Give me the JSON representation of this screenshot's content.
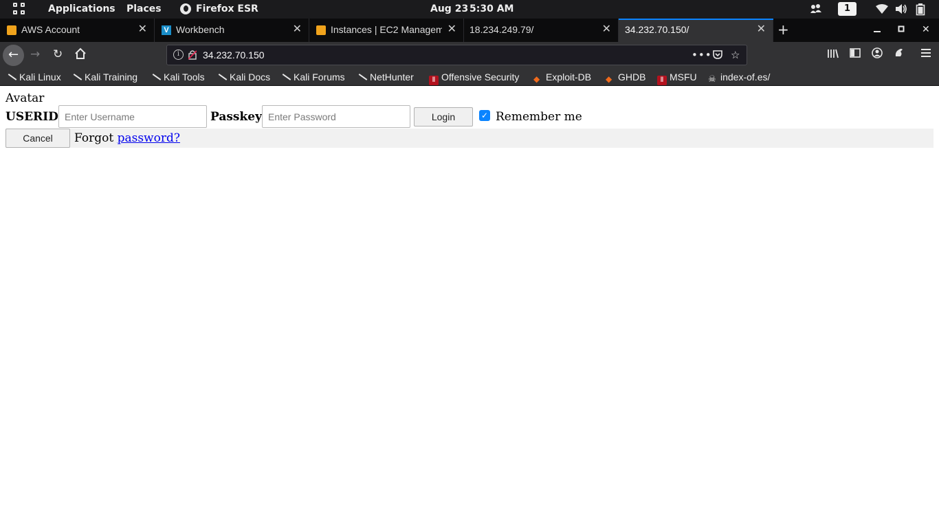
{
  "topbar": {
    "activities_icon": "app-grid-icon",
    "applications": "Applications",
    "places": "Places",
    "firefox": "Firefox ESR",
    "date": "Aug 23",
    "time": "5:30 AM",
    "workspace": "1",
    "tray_icons": [
      "people-icon",
      "wifi-icon",
      "volume-icon",
      "battery-icon"
    ]
  },
  "tabs": [
    {
      "title": "AWS Account",
      "icon": "aws-icon",
      "active": false
    },
    {
      "title": "Workbench",
      "icon": "vocareum-icon",
      "active": false
    },
    {
      "title": "Instances | EC2 Managem",
      "icon": "aws-icon",
      "active": false
    },
    {
      "title": "18.234.249.79/",
      "icon": "",
      "active": false
    },
    {
      "title": "34.232.70.150/",
      "icon": "",
      "active": true
    }
  ],
  "urlbar": {
    "url": "34.232.70.150"
  },
  "bookmarks": [
    {
      "label": "Kali Linux",
      "icon": "kali-icon"
    },
    {
      "label": "Kali Training",
      "icon": "kali-icon"
    },
    {
      "label": "Kali Tools",
      "icon": "kali-icon"
    },
    {
      "label": "Kali Docs",
      "icon": "kali-icon"
    },
    {
      "label": "Kali Forums",
      "icon": "kali-icon"
    },
    {
      "label": "NetHunter",
      "icon": "kali-icon"
    },
    {
      "label": "Offensive Security",
      "icon": "offsec-icon"
    },
    {
      "label": "Exploit-DB",
      "icon": "exploitdb-icon"
    },
    {
      "label": "GHDB",
      "icon": "exploitdb-icon"
    },
    {
      "label": "MSFU",
      "icon": "offsec-icon"
    },
    {
      "label": "index-of.es/",
      "icon": "skull-icon"
    }
  ],
  "page": {
    "avatar": "Avatar",
    "userid_label": "USERID",
    "username_placeholder": "Enter Username",
    "passkey_label": "Passkey",
    "password_placeholder": "Enter Password",
    "login": "Login",
    "remember_checked": true,
    "remember": "Remember me",
    "cancel": "Cancel",
    "forgot_text": "Forgot",
    "forgot_link": "password?"
  },
  "colors": {
    "accent": "#0a84ff",
    "link": "#0000ee",
    "chrome": "#323234"
  }
}
